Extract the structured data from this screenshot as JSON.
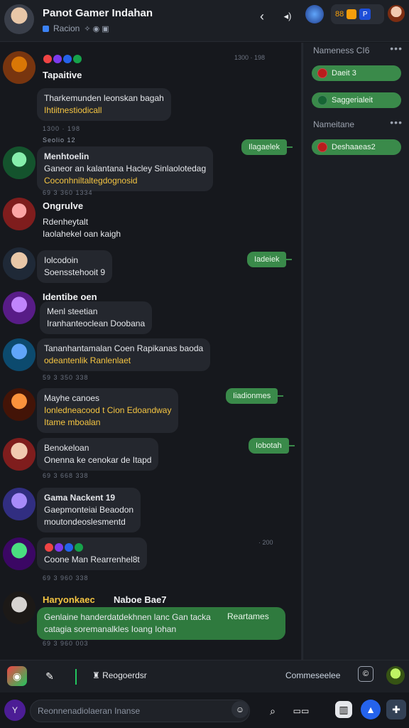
{
  "header": {
    "title": "Panot Gamer Indahan",
    "subtitle": "Racion",
    "badge_count": "88"
  },
  "messages": [
    {
      "name": "Tapaitive",
      "ts": "",
      "lines": [
        "Tharkemunden leonskan bagah",
        "Ihtiitnestiodicall"
      ],
      "time": "1300 · 198"
    },
    {
      "name": "Menhtoelin",
      "ts": "Seolio 12",
      "lines": [
        "Ganeor an kalantana Hacley Sinlaolotedag",
        "Coconhniltaltegdognosid"
      ],
      "time": "69 3 360 1334"
    },
    {
      "name": "Ongrulve",
      "ts": "",
      "lines": [
        "Rdenheytalt",
        "Iaolahekel oan kaigh"
      ],
      "time": "69 3 360 389"
    },
    {
      "name": "Iolcodoin",
      "ts": "",
      "lines": [
        "Soensstehooit 9"
      ],
      "time": ""
    },
    {
      "name": "Identibe oen",
      "ts": "",
      "lines": [
        "Menl steetian",
        "Iranhanteoclean Doobana"
      ],
      "time": ""
    },
    {
      "name": "",
      "ts": "",
      "lines": [
        "Tananhantamalan Coen Rapikanas baoda",
        "odeantenlik Ranlenlaet"
      ],
      "time": "59 3 350 338"
    },
    {
      "name": "Mayhe canoes",
      "ts": "",
      "lines": [
        "Ionledneacood t Cion Edoandway",
        "Itame mboalan"
      ],
      "time": ""
    },
    {
      "name": "Benokeloan",
      "ts": "",
      "lines": [
        "Onenna ke cenokar de Itapd"
      ],
      "time": "69 3 668 338"
    },
    {
      "name": "Gama Nackent 19",
      "ts": "",
      "lines": [
        "Gaepmonteiai Beaodon",
        "moutondeoslesmentd"
      ],
      "time": ""
    },
    {
      "name": "",
      "ts": "",
      "lines": [
        "Coone Man Rearrenhel8t"
      ],
      "time": "69 3 960 338"
    },
    {
      "name": "Haryonkaec",
      "ts": "Naboe Bae7",
      "lines": [
        "Genlaine handerdatdekhnen lanc Gan tacka",
        "catagia soremanalkles Ioang Iohan"
      ],
      "time": "69 3 960 003"
    }
  ],
  "right_tags": [
    "Ilagaelek",
    "Iadeiek",
    "Iiadionmes",
    "Iobotah",
    "Reartames"
  ],
  "timestamps": [
    "1300 · 198",
    "· 200"
  ],
  "sidebar": {
    "section1": "Nameness  CI6",
    "items1": [
      "Daeit 3",
      "Saggerialeit"
    ],
    "section2": "Nameitane",
    "items2": [
      "Deshaaeas2"
    ]
  },
  "bottom": {
    "status_label": "Reogoerdsr",
    "right_label": "Commeseelee",
    "input_placeholder": "Reonnenadiolaeran Inanse"
  },
  "colors": {
    "accent_green": "#3a8a4a",
    "bg": "#16181d",
    "highlight": "#f5c542"
  }
}
